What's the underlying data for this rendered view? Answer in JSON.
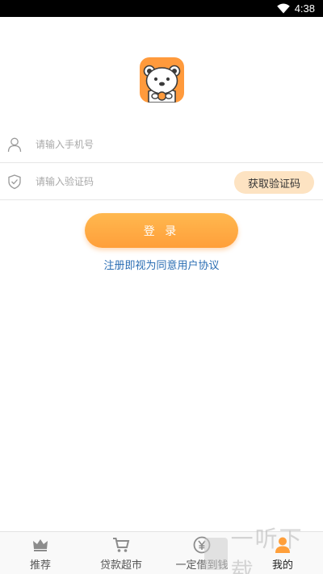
{
  "status_bar": {
    "time": "4:38",
    "wifi_icon": "wifi-icon"
  },
  "logo": {
    "icon": "bear-icon",
    "background": "#ff9a3c"
  },
  "form": {
    "phone": {
      "placeholder": "请输入手机号",
      "value": "",
      "icon": "user-icon"
    },
    "code": {
      "placeholder": "请输入验证码",
      "value": "",
      "icon": "shield-icon"
    },
    "get_code_label": "获取验证码"
  },
  "login_label": "登 录",
  "agreement_label": "注册即视为同意用户协议",
  "tabs": [
    {
      "label": "推荐",
      "icon": "crown-icon",
      "active": false
    },
    {
      "label": "贷款超市",
      "icon": "cart-icon",
      "active": false
    },
    {
      "label": "一定借到钱",
      "icon": "yen-coin-icon",
      "active": false
    },
    {
      "label": "我的",
      "icon": "profile-icon",
      "active": true
    }
  ],
  "watermark": {
    "text": "一听下载"
  },
  "colors": {
    "accent": "#ff9f3a",
    "code_button_bg": "#fde3c2",
    "link": "#2a6db3",
    "active_tab_icon": "#ff9f3a",
    "inactive_tab_icon": "#8c8c8c"
  }
}
